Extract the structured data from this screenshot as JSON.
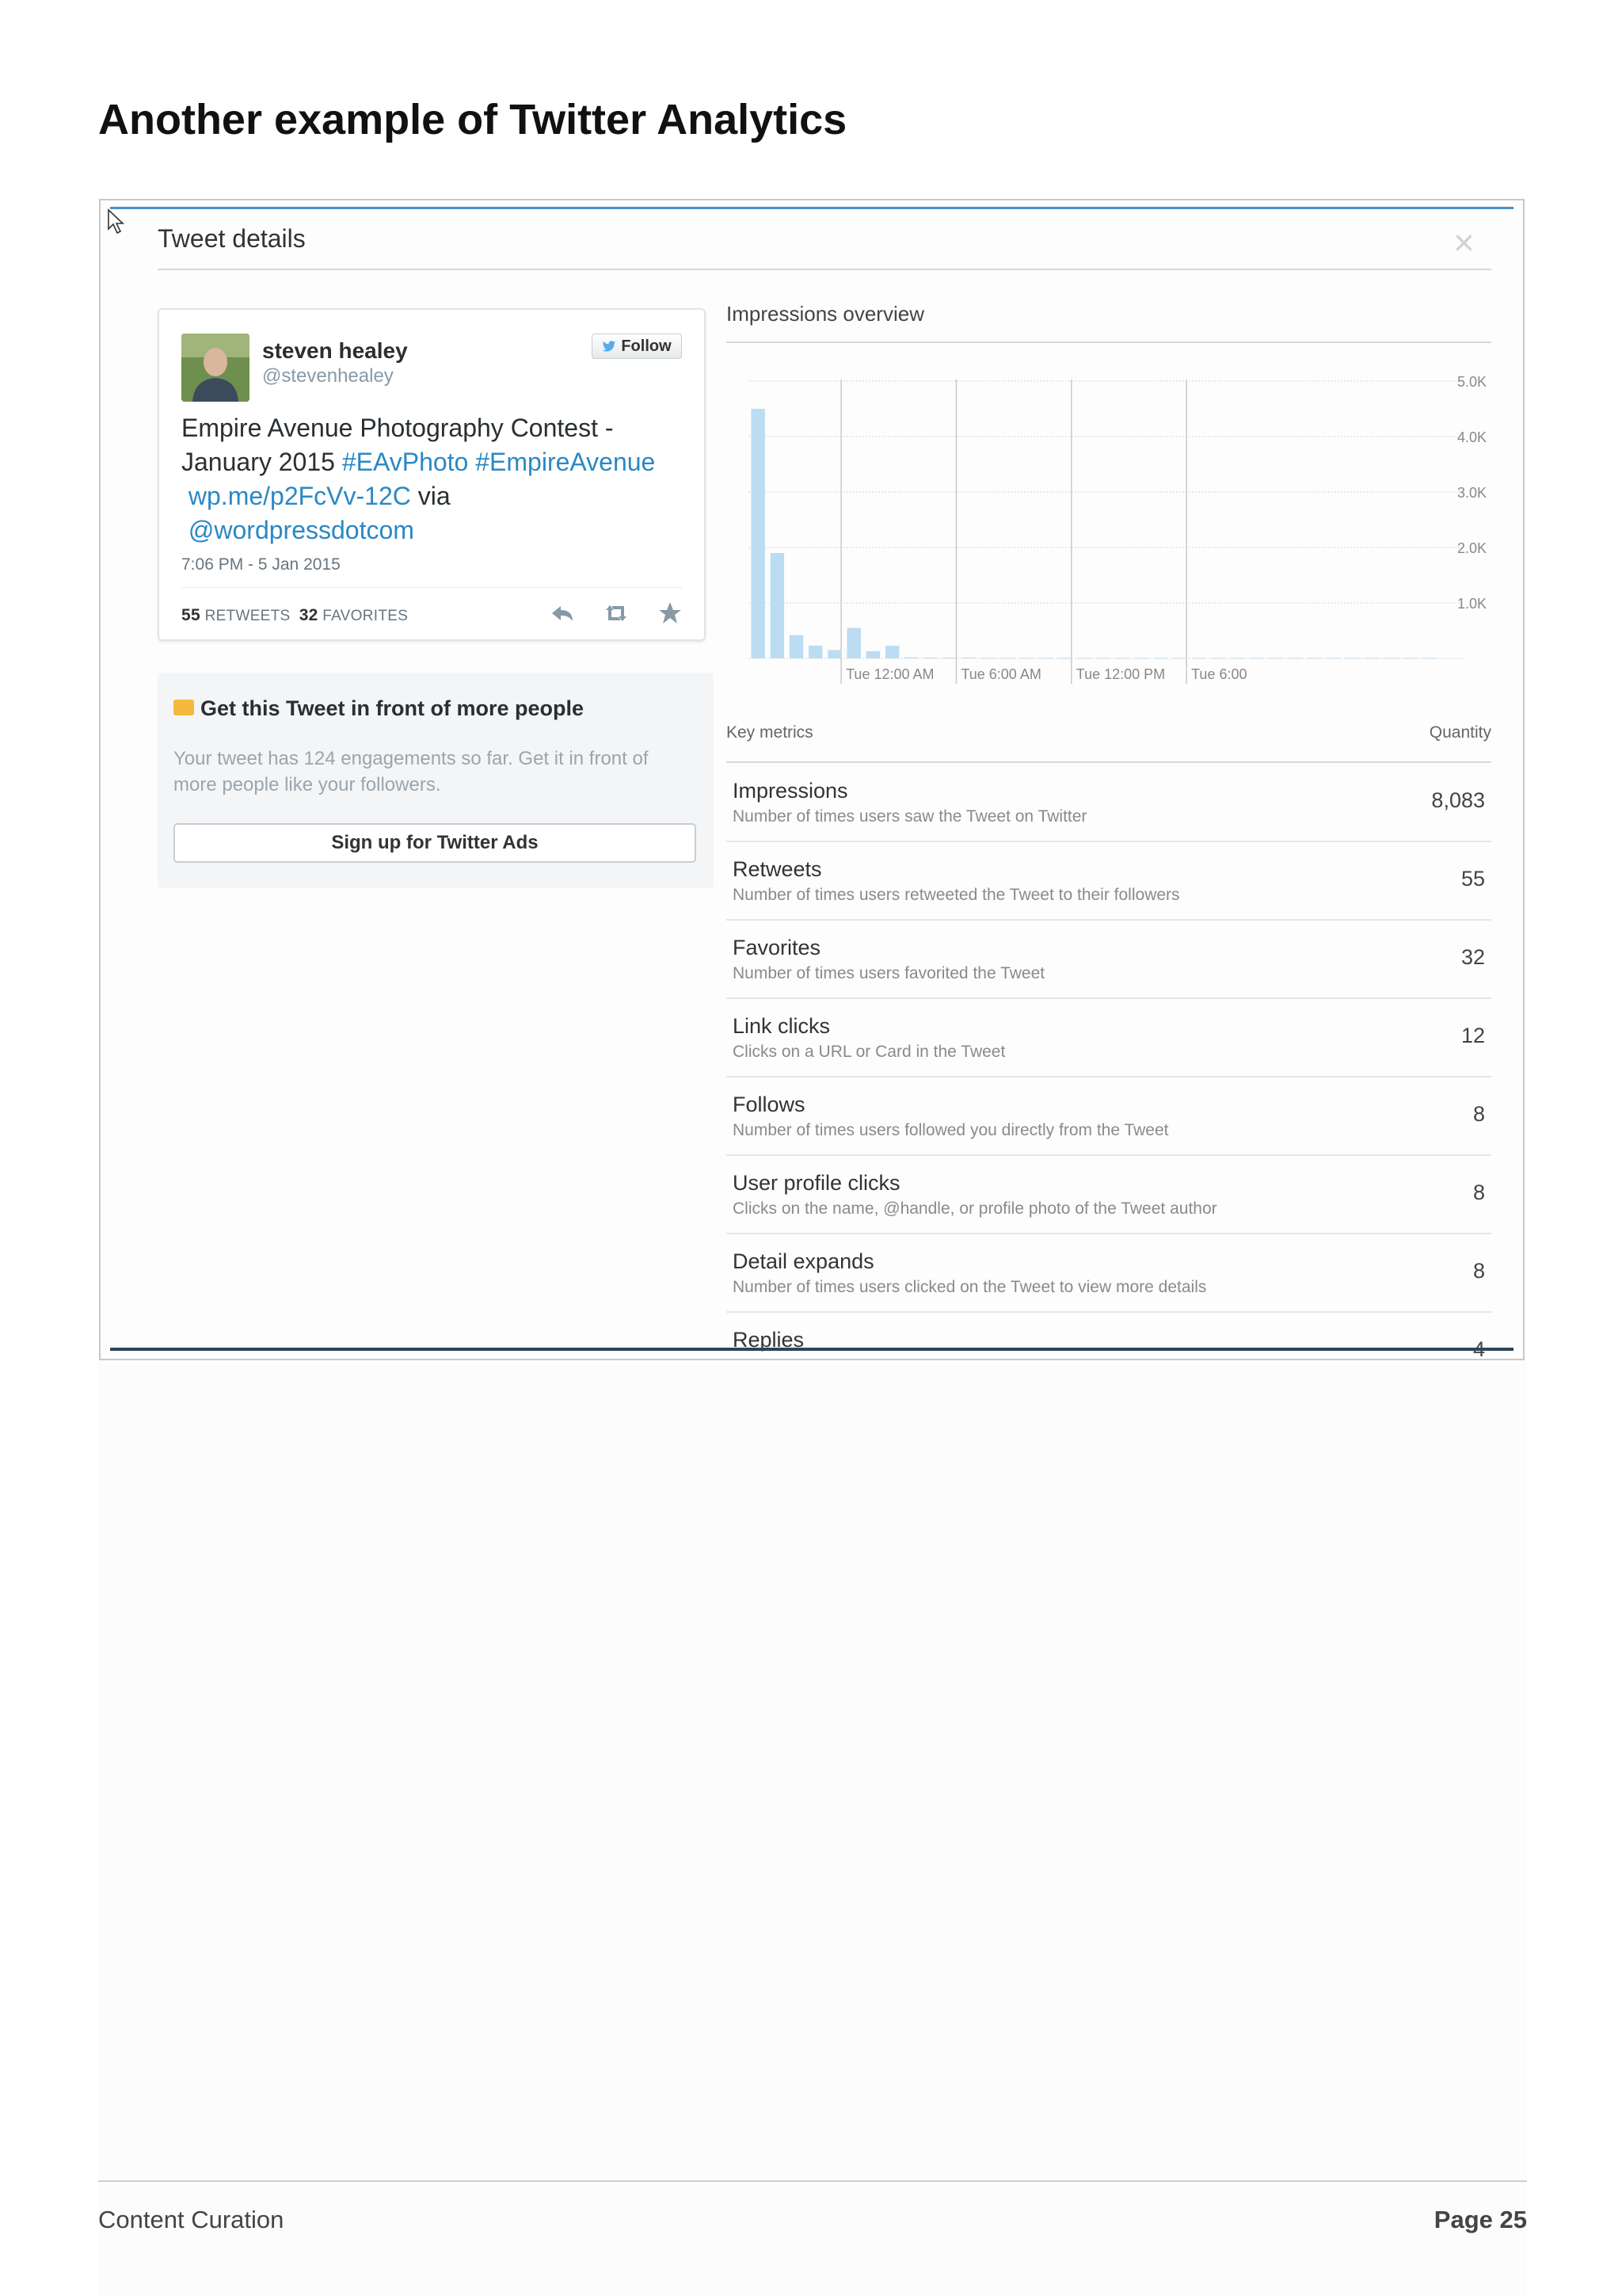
{
  "document": {
    "title": "Another example of Twitter Analytics",
    "footer_left": "Content Curation",
    "footer_right": "Page 25"
  },
  "modal": {
    "title": "Tweet details",
    "close_icon": "close-icon"
  },
  "tweet": {
    "name": "steven healey",
    "handle": "@stevenhealey",
    "follow_label": "Follow",
    "text_line1": "Empire Avenue Photography Contest -",
    "text_line2_plain": "January 2015 ",
    "hashtag1": "#EAvPhoto",
    "hashtag2": "#EmpireAvenue",
    "link": "wp.me/p2FcVv-12C",
    "via": " via",
    "mention": "@wordpressdotcom",
    "time": "7:06 PM - 5 Jan 2015",
    "retweets": "55",
    "retweets_label": "RETWEETS",
    "favorites": "32",
    "favorites_label": "FAVORITES",
    "actions": [
      "reply-icon",
      "retweet-icon",
      "favorite-icon"
    ],
    "link_color": "#2a88c4"
  },
  "promo": {
    "title": "Get this Tweet in front of more people",
    "text": "Your tweet has 124 engagements so far. Get it in front of more people like your followers.",
    "button_label": "Sign up for Twitter Ads",
    "icon_color": "#f5b83d"
  },
  "impressions": {
    "title": "Impressions overview"
  },
  "chart_data": {
    "type": "bar",
    "title": "Impressions overview",
    "ylim": [
      0,
      5000
    ],
    "y_ticks": [
      "5.0K",
      "4.0K",
      "3.0K",
      "2.0K",
      "1.0K"
    ],
    "y_tick_values": [
      5000,
      4000,
      3000,
      2000,
      1000
    ],
    "x_ticks": [
      "Tue 12:00 AM",
      "Tue 6:00 AM",
      "Tue 12:00 PM",
      "Tue 6:00"
    ],
    "values": [
      4500,
      1900,
      420,
      230,
      150,
      550,
      130,
      230,
      20,
      15,
      15,
      15,
      10,
      10,
      10,
      10,
      10,
      10,
      10,
      10,
      10,
      10,
      10,
      10,
      10,
      10,
      10,
      10,
      10,
      10,
      10,
      10,
      10,
      10,
      10,
      10
    ],
    "bar_color": "#bcdcf3",
    "grid": true
  },
  "metrics": {
    "key_metrics_label": "Key metrics",
    "quantity_label": "Quantity",
    "rows": [
      {
        "name": "Impressions",
        "desc": "Number of times users saw the Tweet on Twitter",
        "qty": "8,083"
      },
      {
        "name": "Retweets",
        "desc": "Number of times users retweeted the Tweet to their followers",
        "qty": "55"
      },
      {
        "name": "Favorites",
        "desc": "Number of times users favorited the Tweet",
        "qty": "32"
      },
      {
        "name": "Link clicks",
        "desc": "Clicks on a URL or Card in the Tweet",
        "qty": "12"
      },
      {
        "name": "Follows",
        "desc": "Number of times users followed you directly from the Tweet",
        "qty": "8"
      },
      {
        "name": "User profile clicks",
        "desc": "Clicks on the name, @handle, or profile photo of the Tweet author",
        "qty": "8"
      },
      {
        "name": "Detail expands",
        "desc": "Number of times users clicked on the Tweet to view more details",
        "qty": "8"
      },
      {
        "name": "Replies",
        "desc": "",
        "qty": "4"
      }
    ]
  }
}
